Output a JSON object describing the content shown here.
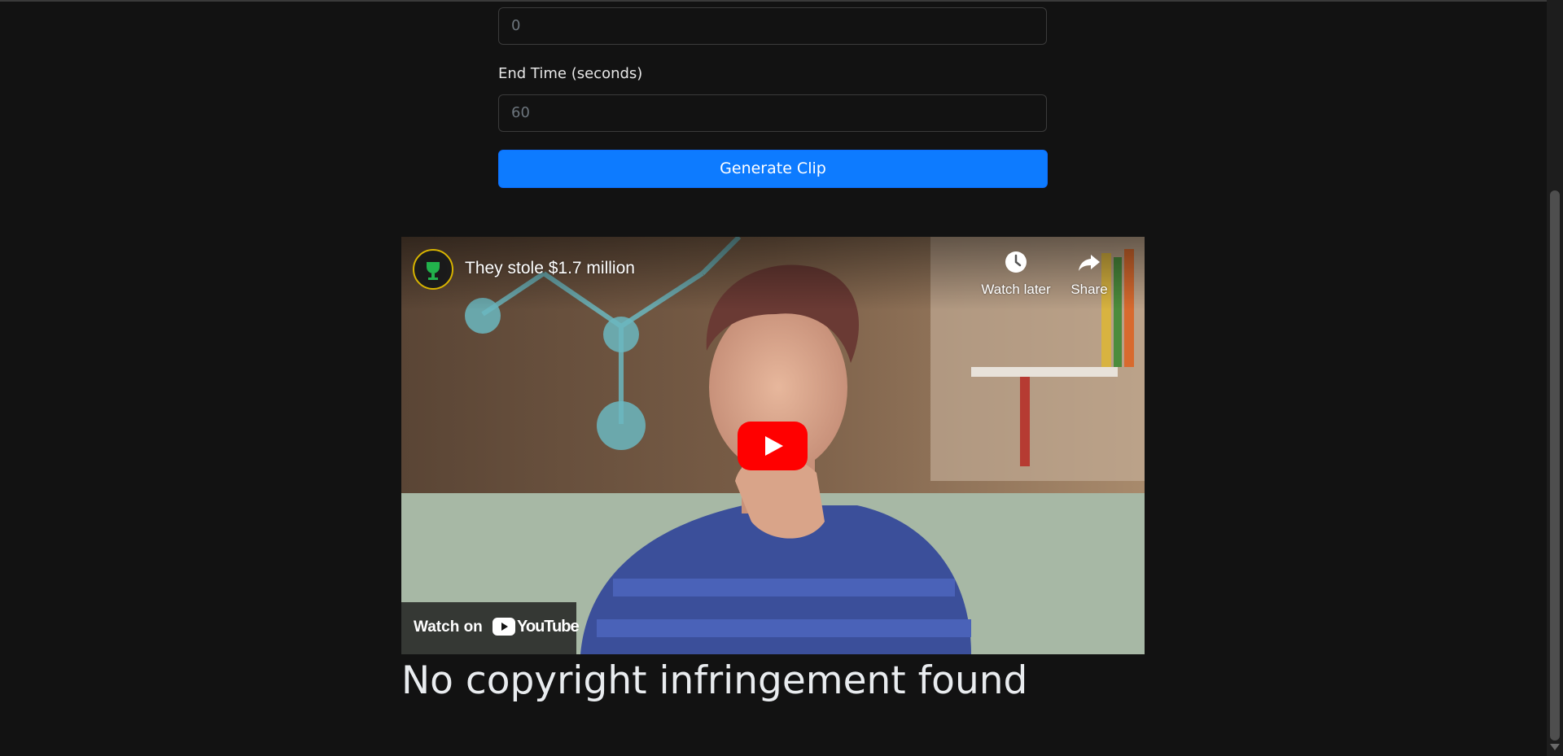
{
  "form": {
    "start_time_value": "0",
    "end_time_label": "End Time (seconds)",
    "end_time_value": "60",
    "generate_button_label": "Generate Clip"
  },
  "video": {
    "title": "They stole $1.7 million",
    "watch_later_label": "Watch later",
    "share_label": "Share",
    "watch_on_label": "Watch on",
    "youtube_wordmark": "YouTube",
    "play_button_color": "#ff0000"
  },
  "result": {
    "heading": "No copyright infringement found"
  },
  "colors": {
    "background": "#121212",
    "primary_button": "#0d7bff",
    "heading_text": "#e9ecef"
  }
}
